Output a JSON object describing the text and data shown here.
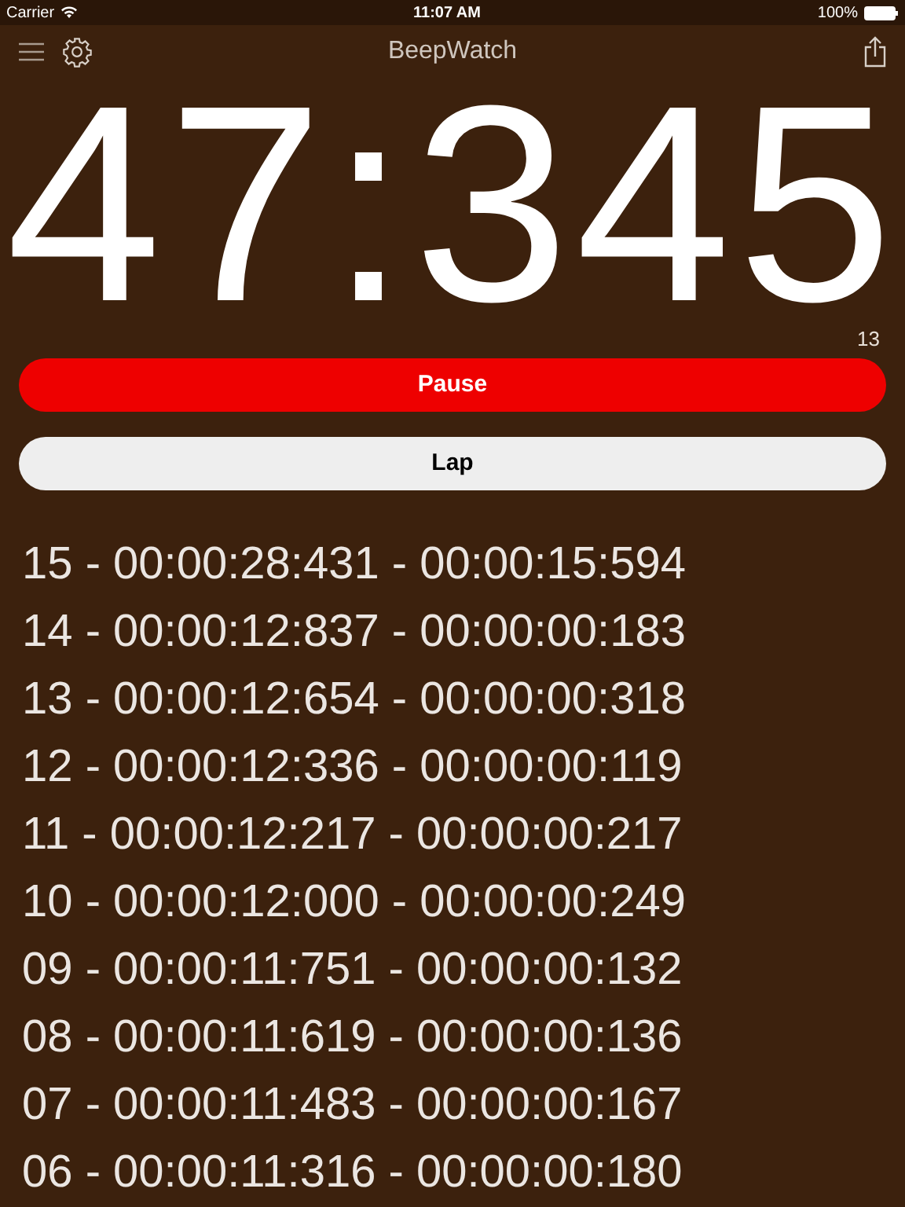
{
  "status_bar": {
    "carrier": "Carrier",
    "time": "11:07 AM",
    "battery": "100%"
  },
  "nav": {
    "title": "BeepWatch"
  },
  "display": {
    "time": "47:345",
    "secondary": "13"
  },
  "buttons": [
    {
      "label": "Pause",
      "kind": "pause"
    },
    {
      "label": "Lap",
      "kind": "lap"
    }
  ],
  "laps": [
    "15 - 00:00:28:431 - 00:00:15:594",
    "14 - 00:00:12:837 - 00:00:00:183",
    "13 - 00:00:12:654 - 00:00:00:318",
    "12 - 00:00:12:336 - 00:00:00:119",
    "11 - 00:00:12:217 - 00:00:00:217",
    "10 - 00:00:12:000 - 00:00:00:249",
    "09 - 00:00:11:751 - 00:00:00:132",
    "08 - 00:00:11:619 - 00:00:00:136",
    "07 - 00:00:11:483 - 00:00:00:167",
    "06 - 00:00:11:316 - 00:00:00:180"
  ]
}
